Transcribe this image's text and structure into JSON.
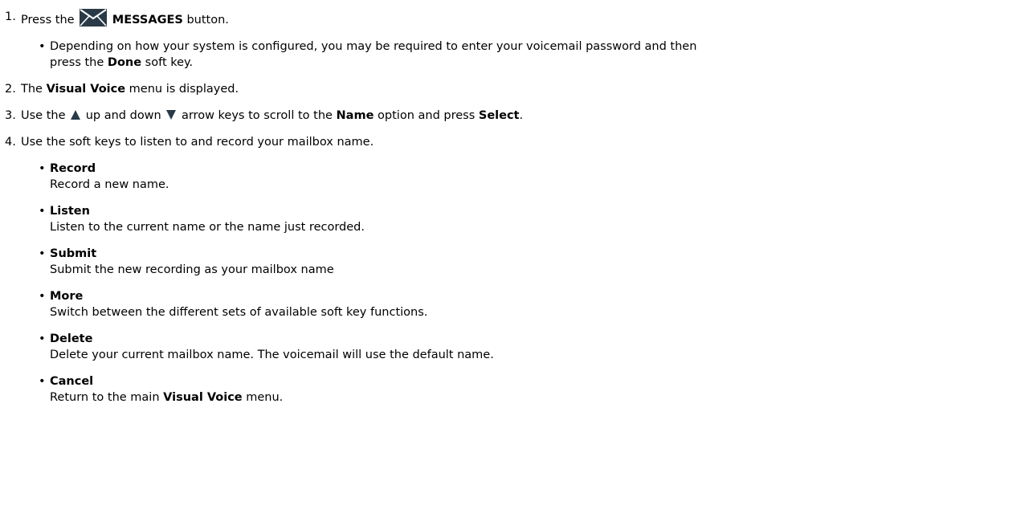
{
  "steps": [
    {
      "num": "1.",
      "pre": "Press the",
      "icon": "messages-envelope-icon",
      "bold": "MESSAGES",
      "post": "button."
    },
    {
      "num": "2.",
      "pre": "The",
      "bold": "Visual Voice",
      "post": "menu is displayed."
    },
    {
      "num": "3.",
      "pre": "Use the",
      "up_icon": "up-arrow-icon",
      "mid": "up and down",
      "down_icon": "down-arrow-icon",
      "mid2": "arrow keys to scroll to the",
      "bold": "Name",
      "mid3": "option and press",
      "bold2": "Select",
      "post": "."
    },
    {
      "num": "4.",
      "text": "Use the soft keys to listen to and record your mailbox name."
    }
  ],
  "step1_note": {
    "pre": "Depending on how your system is configured, you may be required to enter your voicemail password and then",
    "pre2": "press the",
    "bold": "Done",
    "post": "soft key."
  },
  "soft_keys": [
    {
      "name": "Record",
      "desc": "Record a new name."
    },
    {
      "name": "Listen",
      "desc": "Listen to the current name or the name just recorded."
    },
    {
      "name": "Submit",
      "desc": "Submit the new recording as your mailbox name"
    },
    {
      "name": "More",
      "desc": "Switch between the different sets of available soft key functions."
    },
    {
      "name": "Delete",
      "desc": "Delete your current mailbox name. The voicemail will use the default name."
    },
    {
      "name": "Cancel",
      "desc_pre": "Return to the main",
      "desc_bold": "Visual Voice",
      "desc_post": "menu."
    }
  ],
  "colors": {
    "text": "#000000",
    "icon_fill": "#2a3a48",
    "background": "#ffffff"
  }
}
